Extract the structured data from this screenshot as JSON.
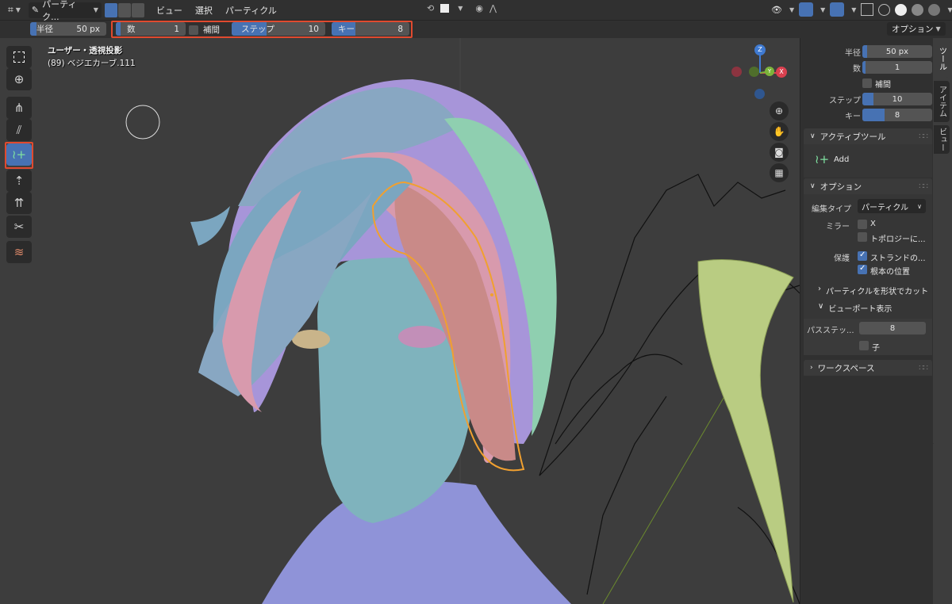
{
  "header": {
    "editor_icon": "particle-edit-icon",
    "mode_label": "パーティク...",
    "menus": [
      "ビュー",
      "選択",
      "パーティクル"
    ],
    "right_options": "オプション"
  },
  "toolsettings": {
    "radius_label": "半径",
    "radius_value": "50 px",
    "count_label": "数",
    "count_value": "1",
    "interpolate_label": "補間",
    "steps_label": "ステップ",
    "steps_value": "10",
    "keys_label": "キー",
    "keys_value": "8",
    "options_label": "オプション"
  },
  "viewport": {
    "view_label": "ユーザー・透視投影",
    "object_label": "(89) ベジエカーブ.111"
  },
  "gizmo": {
    "z": "Z",
    "y": "Y",
    "x": "X"
  },
  "npanel": {
    "radius_label": "半径",
    "radius_value": "50 px",
    "count_label": "数",
    "count_value": "1",
    "interpolate_label": "補間",
    "steps_label": "ステップ",
    "steps_value": "10",
    "keys_label": "キー",
    "keys_value": "8",
    "active_tool_title": "アクティブツール",
    "active_tool_name": "Add",
    "options_title": "オプション",
    "edit_type_label": "編集タイプ",
    "edit_type_value": "パーティクル",
    "mirror_label": "ミラー",
    "mirror_x": "X",
    "mirror_topology": "トポロジーに...",
    "protect_label": "保護",
    "protect_strands": "ストランドの...",
    "protect_root": "根本の位置",
    "cut_shape": "パーティクルを形状でカット",
    "viewport_display": "ビューポート表示",
    "path_steps_label": "パスステッ...",
    "path_steps_value": "8",
    "children_label": "子",
    "workspace_title": "ワークスペース"
  },
  "tabs": [
    "ツール",
    "アイテム",
    "ビュー"
  ],
  "colors": {
    "accent": "#4772b3",
    "highlight": "#e04a2f",
    "panel": "#303030",
    "viewport": "#3d3d3d"
  }
}
